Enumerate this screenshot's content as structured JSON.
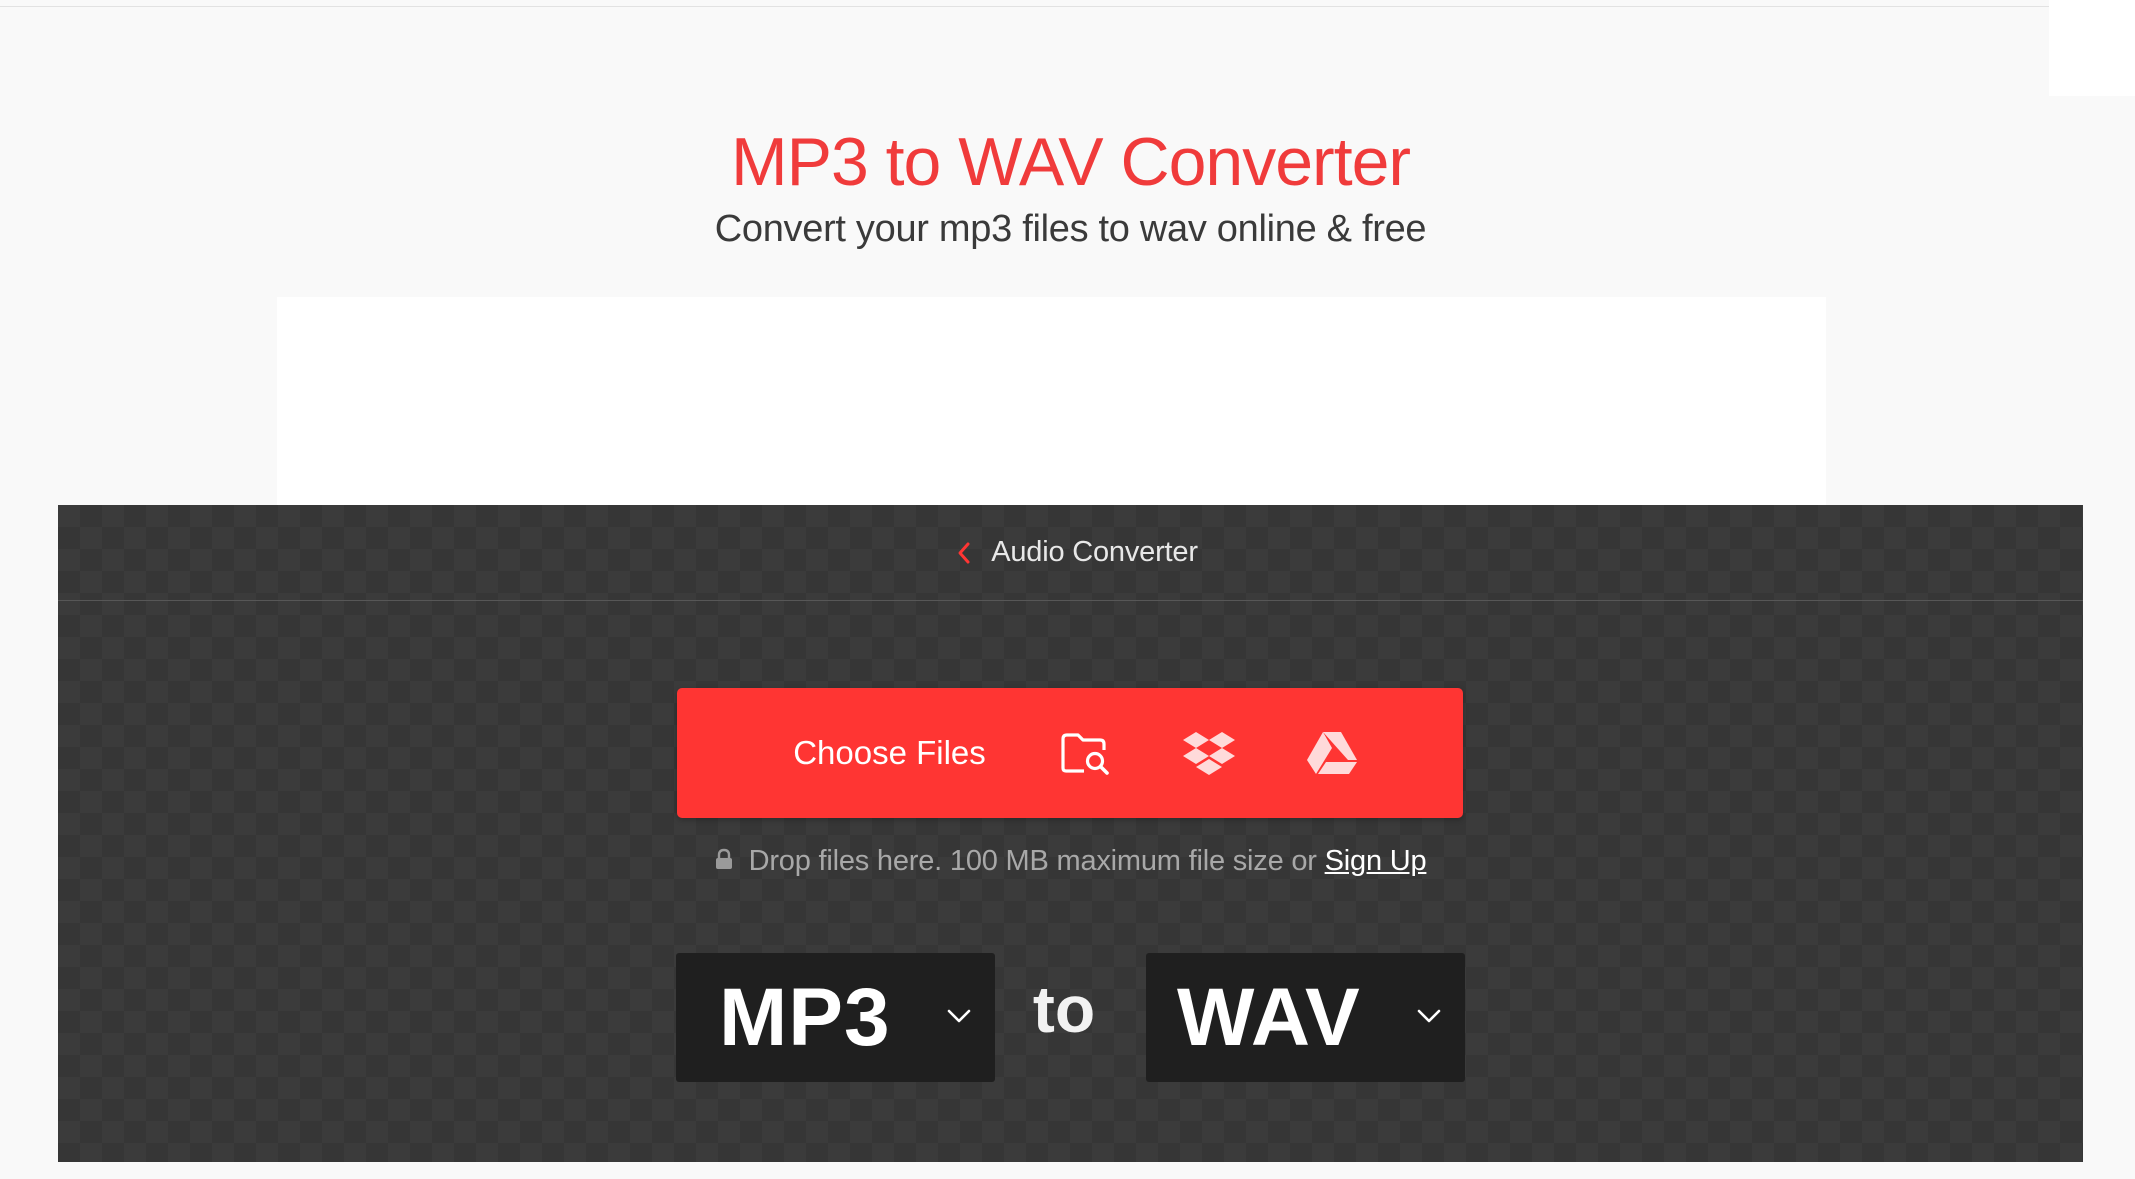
{
  "hero": {
    "title": "MP3 to WAV Converter",
    "subtitle": "Convert your mp3 files to wav online & free"
  },
  "nav": {
    "back_label": "Audio Converter"
  },
  "upload": {
    "choose_label": "Choose Files",
    "sources": [
      {
        "name": "Browse device",
        "icon": "folder-search-icon"
      },
      {
        "name": "Dropbox",
        "icon": "dropbox-icon"
      },
      {
        "name": "Google Drive",
        "icon": "google-drive-icon"
      }
    ],
    "drop_note": "Drop files here. 100 MB maximum file size or",
    "signup_label": "Sign Up"
  },
  "conversion": {
    "from": "MP3",
    "to_label": "to",
    "to": "WAV"
  },
  "colors": {
    "brand_red": "#ff3533",
    "title_red": "#f03b3b",
    "panel_dark": "#3b3b3b",
    "select_bg": "#1f1f1f"
  }
}
